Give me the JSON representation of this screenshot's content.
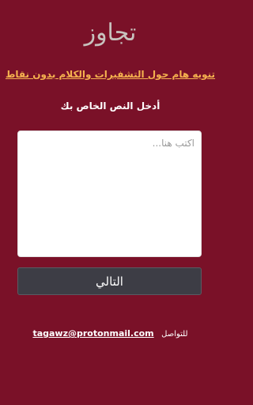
{
  "logo": {
    "text": "تجاوز"
  },
  "notice": {
    "text": "تنويه هام حول التشفيرات والكلام بدون نقاط"
  },
  "prompt": {
    "text": "أدخل النص الخاص بك"
  },
  "input": {
    "placeholder": "اكتب هنا...",
    "value": ""
  },
  "button": {
    "label": "التالي"
  },
  "contact": {
    "label": "للتواصل",
    "email": "tagawz@protonmail.com"
  },
  "colors": {
    "background": "#7a1128",
    "notice": "#f5b24f",
    "button": "#3d3d45"
  }
}
